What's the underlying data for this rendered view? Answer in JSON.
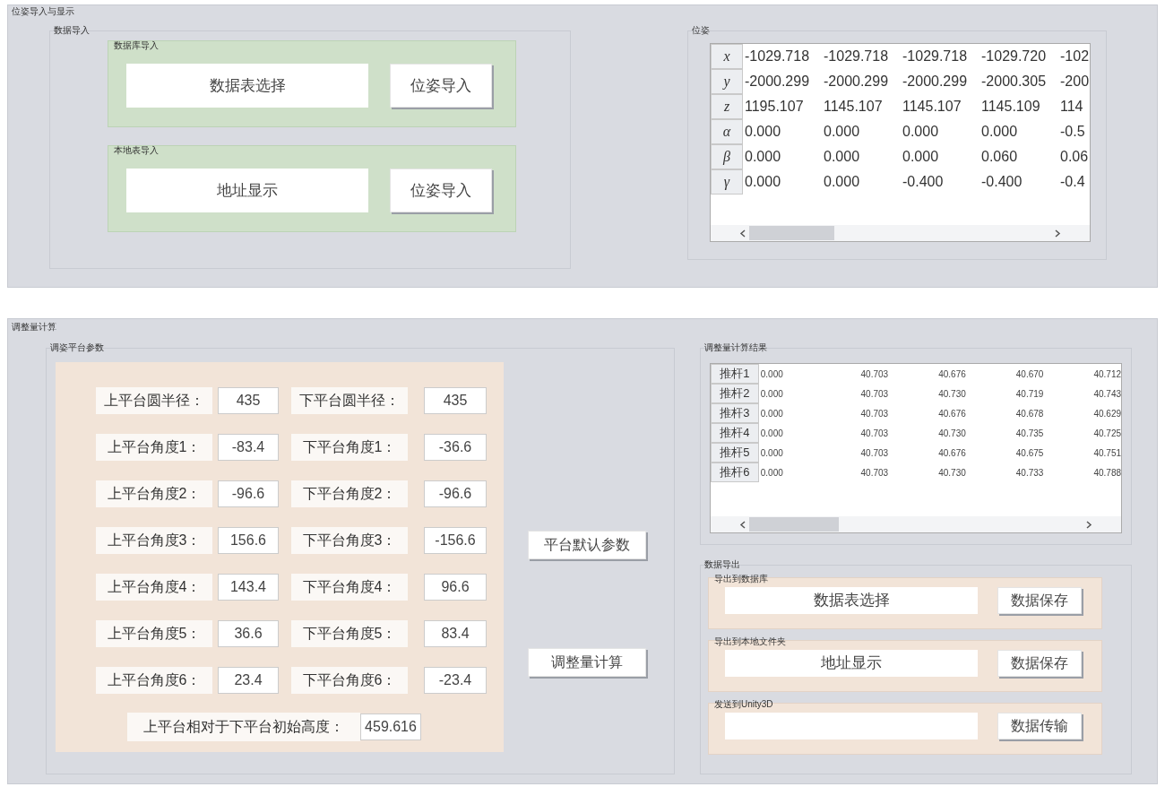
{
  "pose_panel": {
    "title": "位姿导入与显示",
    "data_import": {
      "title": "数据导入",
      "database_import": {
        "title": "数据库导入",
        "field_value": "数据表选择",
        "button": "位姿导入"
      },
      "local_import": {
        "title": "本地表导入",
        "field_value": "地址显示",
        "button": "位姿导入"
      }
    },
    "pose": {
      "title": "位姿",
      "rows": [
        {
          "header": "x",
          "cells": [
            "-1029.718",
            "-1029.718",
            "-1029.718",
            "-1029.720",
            "-102"
          ]
        },
        {
          "header": "y",
          "cells": [
            "-2000.299",
            "-2000.299",
            "-2000.299",
            "-2000.305",
            "-200"
          ]
        },
        {
          "header": "z",
          "cells": [
            "1195.107",
            "1145.107",
            "1145.107",
            "1145.109",
            "114"
          ]
        },
        {
          "header": "α",
          "cells": [
            "0.000",
            "0.000",
            "0.000",
            "0.000",
            "-0.5"
          ]
        },
        {
          "header": "β",
          "cells": [
            "0.000",
            "0.000",
            "0.000",
            "0.060",
            "0.06"
          ]
        },
        {
          "header": "γ",
          "cells": [
            "0.000",
            "0.000",
            "-0.400",
            "-0.400",
            "-0.4"
          ]
        }
      ]
    }
  },
  "calc_panel": {
    "title": "调整量计算",
    "params": {
      "title": "调姿平台参数",
      "rows": [
        {
          "upper_label": "上平台圆半径：",
          "upper_value": "435",
          "lower_label": "下平台圆半径：",
          "lower_value": "435"
        },
        {
          "upper_label": "上平台角度1：",
          "upper_value": "-83.4",
          "lower_label": "下平台角度1：",
          "lower_value": "-36.6"
        },
        {
          "upper_label": "上平台角度2：",
          "upper_value": "-96.6",
          "lower_label": "下平台角度2：",
          "lower_value": "-96.6"
        },
        {
          "upper_label": "上平台角度3：",
          "upper_value": "156.6",
          "lower_label": "下平台角度3：",
          "lower_value": "-156.6"
        },
        {
          "upper_label": "上平台角度4：",
          "upper_value": "143.4",
          "lower_label": "下平台角度4：",
          "lower_value": "96.6"
        },
        {
          "upper_label": "上平台角度5：",
          "upper_value": "36.6",
          "lower_label": "下平台角度5：",
          "lower_value": "83.4"
        },
        {
          "upper_label": "上平台角度6：",
          "upper_value": "23.4",
          "lower_label": "下平台角度6：",
          "lower_value": "-23.4"
        }
      ],
      "height_label": "上平台相对于下平台初始高度：",
      "height_value": "459.616"
    },
    "buttons": [
      "平台默认参数",
      "调整量计算"
    ],
    "results": {
      "title": "调整量计算结果",
      "rows": [
        {
          "header": "推杆1",
          "cells": [
            "0.000",
            "40.703",
            "40.676",
            "40.670",
            "40.712"
          ]
        },
        {
          "header": "推杆2",
          "cells": [
            "0.000",
            "40.703",
            "40.730",
            "40.719",
            "40.743"
          ]
        },
        {
          "header": "推杆3",
          "cells": [
            "0.000",
            "40.703",
            "40.676",
            "40.678",
            "40.629"
          ]
        },
        {
          "header": "推杆4",
          "cells": [
            "0.000",
            "40.703",
            "40.730",
            "40.735",
            "40.725"
          ]
        },
        {
          "header": "推杆5",
          "cells": [
            "0.000",
            "40.703",
            "40.676",
            "40.675",
            "40.751"
          ]
        },
        {
          "header": "推杆6",
          "cells": [
            "0.000",
            "40.703",
            "40.730",
            "40.733",
            "40.788"
          ]
        }
      ]
    },
    "export": {
      "title": "数据导出",
      "groups": [
        {
          "title": "导出到数据库",
          "field_value": "数据表选择",
          "button": "数据保存"
        },
        {
          "title": "导出到本地文件夹",
          "field_value": "地址显示",
          "button": "数据保存"
        },
        {
          "title": "发送到Unity3D",
          "button": "数据传输"
        }
      ]
    }
  }
}
